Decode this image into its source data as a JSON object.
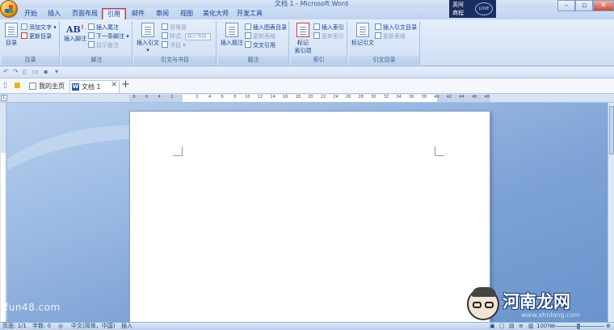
{
  "window": {
    "title": "文档 1 - Microsoft Word"
  },
  "ribbon_tabs": [
    {
      "label": "开始"
    },
    {
      "label": "插入"
    },
    {
      "label": "页面布局"
    },
    {
      "label": "引用"
    },
    {
      "label": "邮件"
    },
    {
      "label": "审阅"
    },
    {
      "label": "视图"
    },
    {
      "label": "美化大师"
    },
    {
      "label": "开发工具"
    }
  ],
  "active_tab": "引用",
  "badge": {
    "line1": "英阿",
    "line2": "商程",
    "heart": "LOVE"
  },
  "groups": {
    "toc": {
      "label": "目录",
      "big": "目录",
      "add_text": "添加文字",
      "update_toc": "更新目录"
    },
    "footnotes": {
      "label": "脚注",
      "big": "插入脚注",
      "insert_endnote": "插入尾注",
      "next_footnote": "下一条脚注",
      "show_notes": "显示备注"
    },
    "citations": {
      "label": "引文与书目",
      "big": "插入引文",
      "manage_sources": "管理源",
      "style": "样式:",
      "style_value": "缺少书目",
      "bibliography": "书目"
    },
    "captions": {
      "label": "题注",
      "big": "插入题注",
      "insert_table_of_figures": "插入图表目录",
      "update_table": "更新表格",
      "cross_reference": "交叉引用"
    },
    "index": {
      "label": "索引",
      "big_line1": "标记",
      "big_line2": "索引项",
      "insert_index": "插入索引",
      "update_index": "更新索引"
    },
    "table_of_authorities": {
      "label": "引文目录",
      "big": "标记引文",
      "insert": "插入引文目录",
      "update": "更新表格"
    }
  },
  "doc_tabs": [
    {
      "label": "我的主页"
    },
    {
      "label": "文档 1"
    }
  ],
  "ruler_ticks": [
    "8",
    "6",
    "4",
    "2",
    "",
    "2",
    "4",
    "6",
    "8",
    "10",
    "12",
    "14",
    "16",
    "18",
    "20",
    "22",
    "24",
    "26",
    "28",
    "30",
    "32",
    "34",
    "36",
    "38",
    "40",
    "42",
    "44",
    "46",
    "48"
  ],
  "status": {
    "page": "页面: 1/1",
    "words": "字数: 0",
    "language": "中文(简体，中国)",
    "mode": "插入",
    "zoom": "100%"
  },
  "zoom_percent": 100,
  "watermark": {
    "left": "fun48.com",
    "right": "河南龙网",
    "site": "www.xhnlong.com"
  }
}
